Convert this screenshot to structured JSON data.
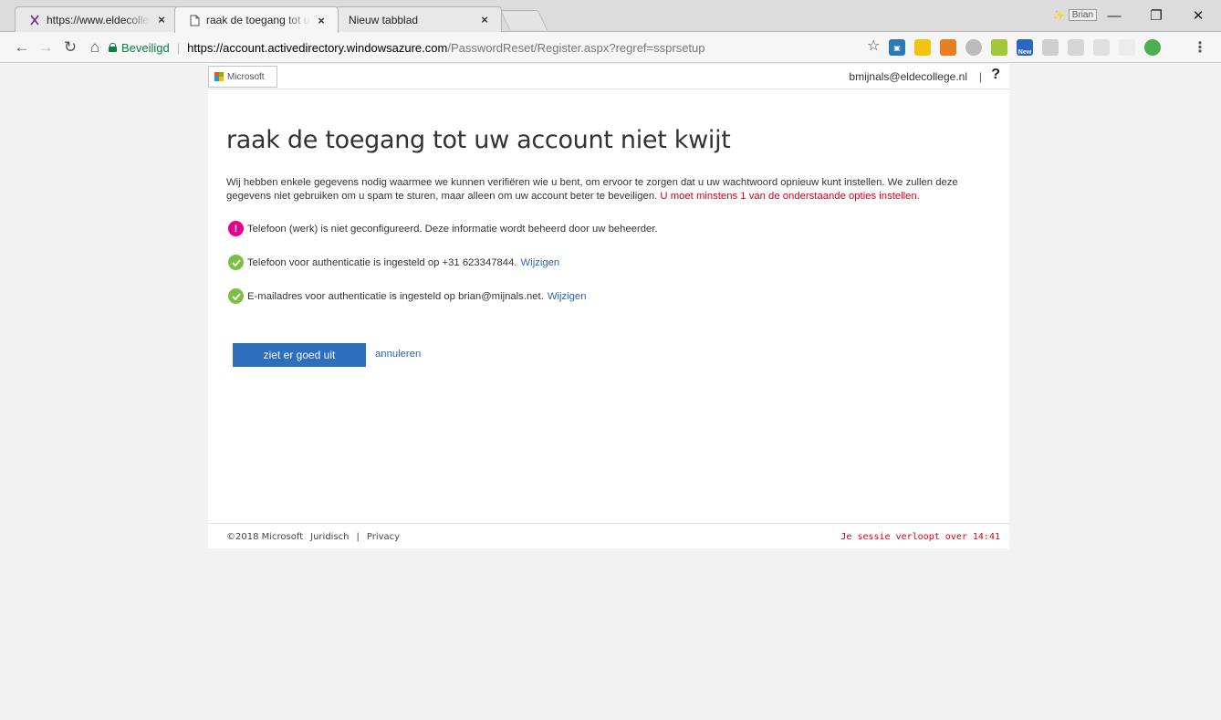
{
  "browser": {
    "tabs": [
      {
        "title": "https://www.eldecollege.nl/",
        "close": "×",
        "favicon": "x-favicon"
      },
      {
        "title": "raak de toegang tot uw account",
        "close": "×",
        "favicon": "document-icon"
      },
      {
        "title": "Nieuw tabblad",
        "close": "×",
        "favicon": "none"
      }
    ],
    "profile_name": "Brian",
    "window_controls": {
      "minimize": "—",
      "restore": "❐",
      "close": "✕"
    },
    "nav": {
      "back": "←",
      "forward": "→",
      "reload": "↻",
      "home": "⌂"
    },
    "secure_label": "Beveiligd",
    "url_host": "https://account.activedirectory.windowsazure.com",
    "url_path": "/PasswordReset/Register.aspx?regref=ssprsetup",
    "bookmark_icon": "☆",
    "extensions_new_badge": "New",
    "menu": "⋮"
  },
  "header": {
    "logo_text": "Microsoft",
    "user_email": "bmijnals@eldecollege.nl",
    "divider": "|",
    "help": "?"
  },
  "main": {
    "title": "raak de toegang tot uw account niet kwijt",
    "intro": "Wij hebben enkele gegevens nodig waarmee we kunnen verifiëren wie u bent, om ervoor te zorgen dat u uw wachtwoord opnieuw kunt instellen. We zullen deze gegevens niet gebruiken om u spam te sturen, maar alleen om uw account beter te beveiligen.",
    "intro_warning": "U moet minstens 1 van de onderstaande opties instellen.",
    "items": [
      {
        "status": "error",
        "text": "Telefoon (werk) is niet geconfigureerd. Deze informatie wordt beheerd door uw beheerder.",
        "link": ""
      },
      {
        "status": "ok",
        "text": "Telefoon voor authenticatie is ingesteld op +31 623347844.",
        "link": "Wijzigen"
      },
      {
        "status": "ok",
        "text": "E-mailadres voor authenticatie is ingesteld op brian@mijnals.net.",
        "link": "Wijzigen"
      }
    ],
    "confirm_button": "ziet er goed uit",
    "cancel_link": "annuleren"
  },
  "footer": {
    "copyright": "©2018 Microsoft",
    "legal": "Juridisch",
    "sep": "|",
    "privacy": "Privacy",
    "session": "Je sessie verloopt over 14:41"
  },
  "colors": {
    "accent": "#2e6fbd",
    "link": "#2b63b8",
    "error": "#e3008c",
    "warning_text": "#d6001c",
    "success": "#7bc043"
  }
}
